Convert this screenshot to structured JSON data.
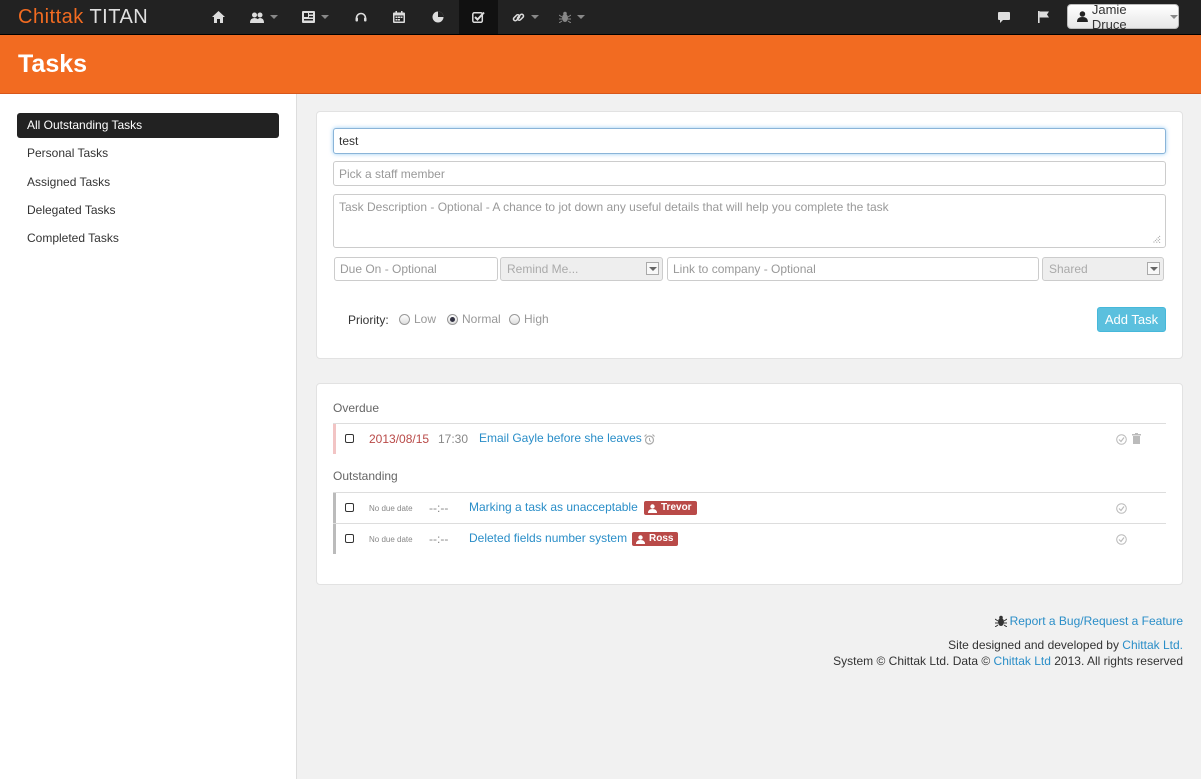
{
  "brand": {
    "part1": "Chittak",
    "part2": "TITAN"
  },
  "navbar": {
    "icons": [
      "home-icon",
      "users-icon",
      "contacts-icon",
      "support-icon",
      "calendar-icon",
      "reports-icon",
      "tasks-icon",
      "links-icon",
      "bug-icon",
      "chat-icon",
      "flag-icon"
    ],
    "user_name": "Jamie Druce"
  },
  "header": {
    "title": "Tasks"
  },
  "sidebar": {
    "items": [
      {
        "label": "All Outstanding Tasks",
        "active": true
      },
      {
        "label": "Personal Tasks"
      },
      {
        "label": "Assigned Tasks"
      },
      {
        "label": "Delegated Tasks"
      },
      {
        "label": "Completed Tasks"
      }
    ]
  },
  "form": {
    "task_name_value": "test",
    "staff_placeholder": "Pick a staff member",
    "description_placeholder": "Task Description - Optional - A chance to jot down any useful details that will help you complete the task",
    "due_placeholder": "Due On - Optional",
    "remind_value": "Remind Me...",
    "company_placeholder": "Link to company - Optional",
    "shared_value": "Shared",
    "priority_label": "Priority:",
    "priorities": [
      "Low",
      "Normal",
      "High"
    ],
    "priority_selected": "Normal",
    "add_label": "Add Task"
  },
  "tasks": {
    "overdue_label": "Overdue",
    "outstanding_label": "Outstanding",
    "overdue": [
      {
        "date": "2013/08/15",
        "time": "17:30",
        "title": "Email Gayle before she leaves"
      }
    ],
    "outstanding": [
      {
        "date": "No due date",
        "time": "--:--",
        "title": "Marking a task as unacceptable",
        "assignee": "Trevor"
      },
      {
        "date": "No due date",
        "time": "--:--",
        "title": "Deleted fields number system",
        "assignee": "Ross"
      }
    ]
  },
  "footer": {
    "report_link": "Report a Bug/Request a Feature",
    "designed_prefix": "Site designed and developed by ",
    "designed_link": "Chittak Ltd.",
    "copyright_prefix": "System © Chittak Ltd. Data © ",
    "copyright_link": "Chittak Ltd",
    "copyright_suffix": " 2013. All rights reserved"
  },
  "colors": {
    "accent": "#f26b21",
    "link": "#2a8ec8",
    "badge": "#b94a48",
    "button": "#5bc0de"
  }
}
